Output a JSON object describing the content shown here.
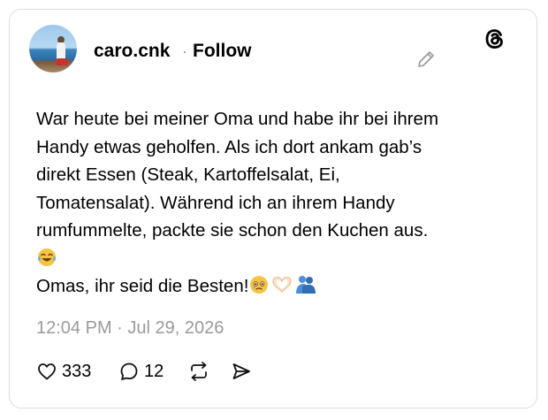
{
  "post": {
    "username": "caro.cnk",
    "separator": "·",
    "follow_label": "Follow",
    "text_lines": [
      "War heute bei meiner Oma und habe ihr bei ihrem",
      "Handy etwas geholfen. Als ich dort ankam gab’s",
      "direkt Essen (Steak, Kartoffelsalat, Ei,",
      "Tomatensalat). Während ich an ihrem Handy",
      "rumfummelte, packte sie schon den Kuchen aus."
    ],
    "last_line": "Omas, ihr seid die Besten!",
    "timestamp": "12:04 PM · Jul 29, 2026"
  },
  "actions": {
    "likes": "333",
    "replies": "12"
  },
  "icons": {
    "avatar": "profile-photo",
    "edit": "pencil-icon",
    "logo": "threads-logo",
    "like": "heart-icon",
    "reply": "reply-bubble-icon",
    "repost": "repost-icon",
    "share": "send-icon",
    "emoji_laugh": "face-with-tears-of-joy",
    "emoji_tear": "face-holding-back-tears",
    "emoji_heart_hands": "heart-hands",
    "emoji_hug": "people-hugging"
  }
}
